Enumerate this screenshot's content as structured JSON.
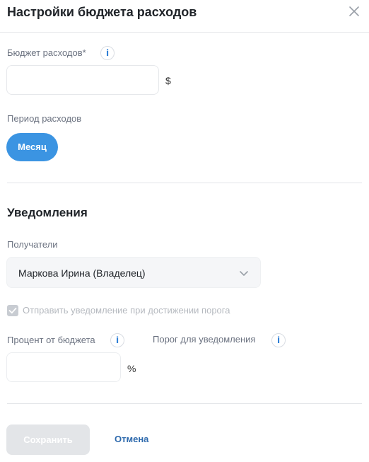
{
  "dialog": {
    "title": "Настройки бюджета расходов",
    "close_icon": "close-icon"
  },
  "budget": {
    "label": "Бюджет расходов*",
    "value": "",
    "placeholder": "",
    "unit": "$",
    "info_icon": "info-icon"
  },
  "period": {
    "label": "Период расходов",
    "selected": "Месяц"
  },
  "notifications": {
    "title": "Уведомления",
    "recipients_label": "Получатели",
    "recipients_value": "Маркова Ирина (Владелец)",
    "checkbox_label": "Отправить уведомление при достижении порога",
    "checkbox_checked": true,
    "percent_label": "Процент от бюджета",
    "percent_value": "",
    "percent_unit": "%",
    "threshold_label": "Порог для уведомления"
  },
  "actions": {
    "save_label": "Сохранить",
    "cancel_label": "Отмена"
  },
  "colors": {
    "accent": "#3b94e2",
    "link": "#2e6aad",
    "disabled": "#e3e5e8"
  }
}
